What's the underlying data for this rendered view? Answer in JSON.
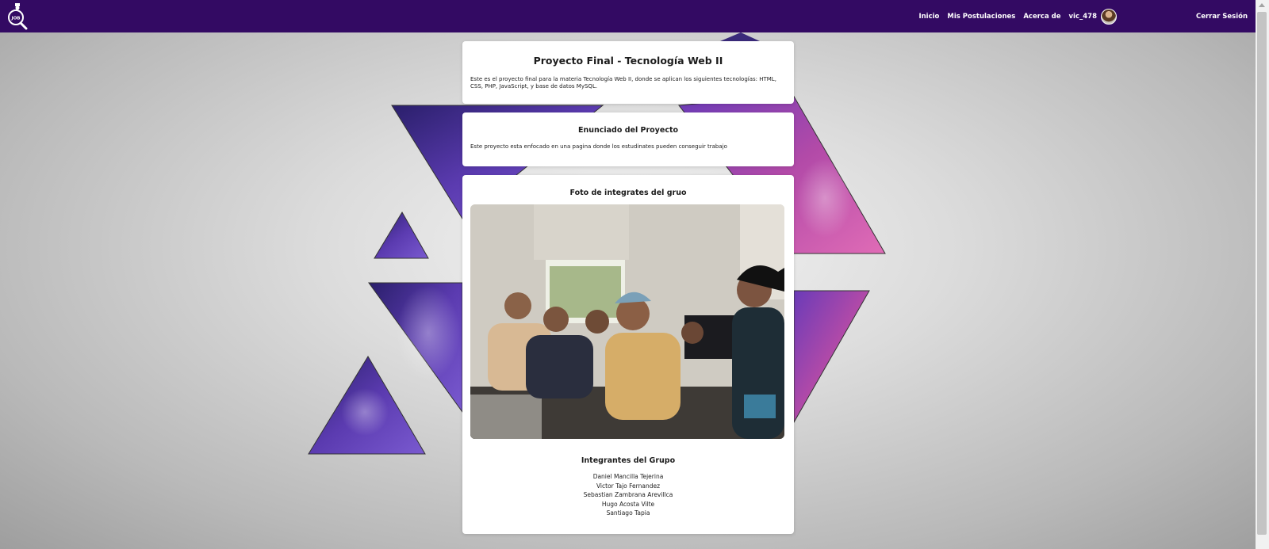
{
  "navbar": {
    "logo_icon": "job-search-logo-icon",
    "links": [
      {
        "label": "Inicio"
      },
      {
        "label": "Mis Postulaciones"
      },
      {
        "label": "Acerca de"
      },
      {
        "label": "vic_478"
      }
    ],
    "logout_label": "Cerrar Sesión",
    "background_color": "#330a63"
  },
  "project": {
    "title": "Proyecto Final - Tecnología Web II",
    "description": "Este es el proyecto final para la materia Tecnología Web II, donde se aplican los siguientes tecnologías: HTML, CSS, PHP, JavaScript, y base de datos MySQL."
  },
  "statement": {
    "title": "Enunciado del Proyecto",
    "text": "Este proyecto esta enfocado en una pagina donde los estudinates pueden conseguir trabajo"
  },
  "group_photo": {
    "title": "Foto de integrates del gruo"
  },
  "members": {
    "title": "Integrantes del Grupo",
    "list": [
      "Daniel Mancilla Tejerina",
      "Victor Tajo Fernandez",
      "Sebastian Zambrana Arevillca",
      "Hugo Acosta Vilte",
      "Santiago Tapia"
    ]
  }
}
